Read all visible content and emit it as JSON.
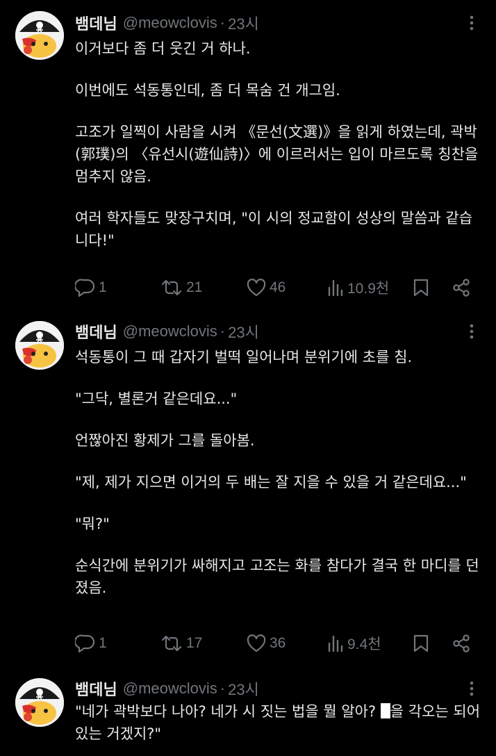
{
  "colors": {
    "background": "#000000",
    "text": "#e7e9ea",
    "muted": "#71767b"
  },
  "icons": [
    "reply-icon",
    "retweet-icon",
    "like-icon",
    "views-icon",
    "bookmark-icon",
    "share-icon",
    "more-icon"
  ],
  "tweets": [
    {
      "author": {
        "name": "뱀데님",
        "handle": "@meowclovis",
        "dot": "·",
        "time": "23시"
      },
      "paragraphs": [
        "이거보다 좀 더 웃긴 거 하나.",
        "이번에도 석동통인데, 좀 더 목숨 건 개그임.",
        "고조가 일찍이 사람을 시켜 《문선(文選)》을 읽게 하였는데, 곽박(郭璞)의 〈유선시(遊仙詩)〉에 이르러서는 입이 마르도록 칭찬을 멈추지 않음.",
        "여러 학자들도 맞장구치며, \"이 시의 정교함이 성상의 말씀과 같습니다!\""
      ],
      "stats": {
        "replies": "1",
        "retweets": "21",
        "likes": "46",
        "views": "10.9천"
      }
    },
    {
      "author": {
        "name": "뱀데님",
        "handle": "@meowclovis",
        "dot": "·",
        "time": "23시"
      },
      "paragraphs": [
        "석동통이 그 때 갑자기 벌떡 일어나며 분위기에 초를 침.",
        "\"그닥, 별론거 같은데요...\"",
        "언짢아진 황제가 그를 돌아봄.",
        "\"제, 제가 지으면 이거의 두 배는 잘 지을 수 있을 거 같은데요...\"",
        "\"뭐?\"",
        "순식간에 분위기가 싸해지고 고조는 화를 참다가 결국 한 마디를 던졌음."
      ],
      "stats": {
        "replies": "1",
        "retweets": "17",
        "likes": "36",
        "views": "9.4천"
      }
    },
    {
      "author": {
        "name": "뱀데님",
        "handle": "@meowclovis",
        "dot": "·",
        "time": "23시"
      },
      "paragraph_before_redaction": "\"네가 곽박보다 나아? 네가 시 짓는 법을 뭘 알아? ",
      "paragraph_after_redaction": "을 각오는 되어 있는 거겠지?\""
    }
  ]
}
